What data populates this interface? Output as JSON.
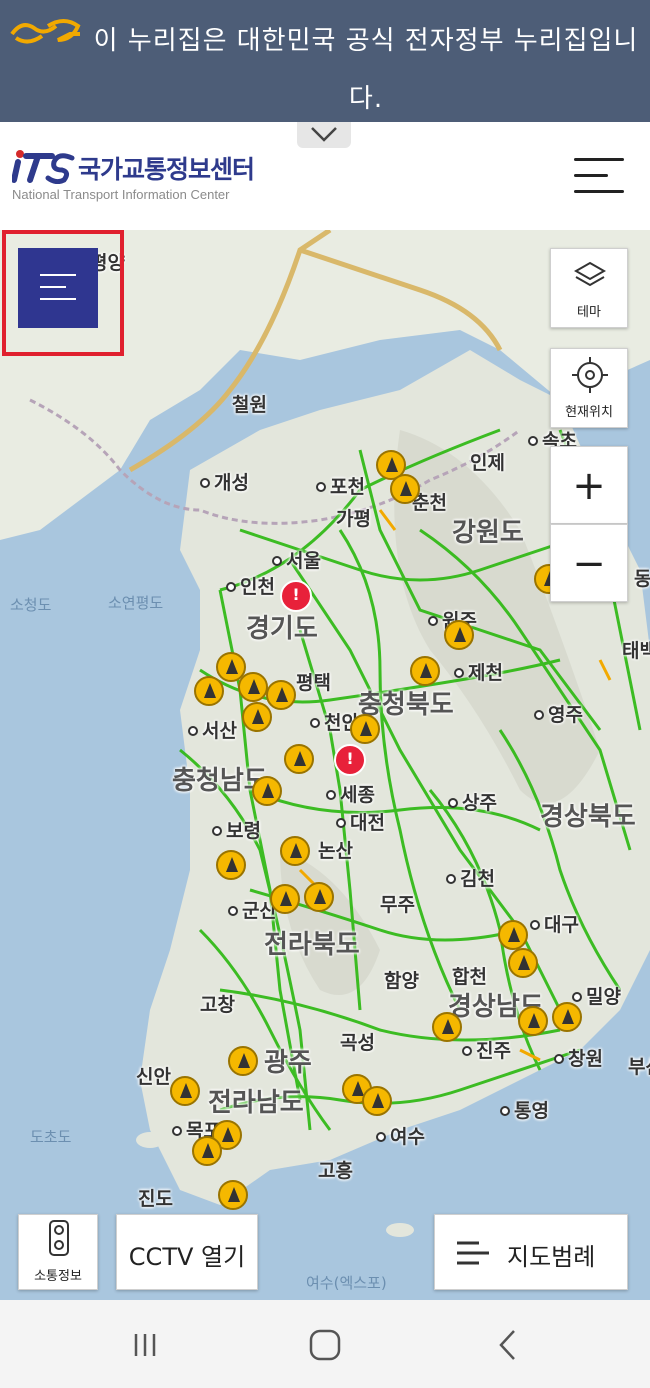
{
  "gov_banner": {
    "text": "이 누리집은 대한민국 공식 전자정부 누리집입니다.",
    "logo_icon": "egovernment-logo-icon"
  },
  "header": {
    "logo_ko": "국가교통정보센터",
    "logo_en": "National Transport Information Center",
    "menu_icon": "hamburger-icon"
  },
  "map": {
    "places": {
      "cheorwon": "철원",
      "gaeseong": "개성",
      "pocheon": "포천",
      "gapyeong": "가평",
      "inje": "인제",
      "sokcho": "속초",
      "chuncheon": "춘천",
      "gangwondo": "강원도",
      "seoul": "서울",
      "incheon": "인천",
      "gyeonggido": "경기도",
      "wonju": "원주",
      "jecheon": "제천",
      "pyeongtaek": "평택",
      "chungcheongbukdo": "충청북도",
      "yeongju": "영주",
      "seosan": "서산",
      "cheonan": "천안",
      "chungcheongnamdo": "충청남도",
      "sejong": "세종",
      "daejeon": "대전",
      "sangju": "상주",
      "gyeongsangbukdo": "경상북도",
      "boryeong": "보령",
      "nonsan": "논산",
      "gimcheon": "김천",
      "gunsan": "군산",
      "muju": "무주",
      "daegu": "대구",
      "jeollabukdo": "전라북도",
      "gochang": "고창",
      "hamyang": "함양",
      "hapcheon": "합천",
      "gyeongsangnamdo": "경상남도",
      "miryang": "밀양",
      "gwangju": "광주",
      "gokseong": "곡성",
      "jinju": "진주",
      "changwon": "창원",
      "sinan": "신안",
      "jeollanamdo": "전라남도",
      "tongyeong": "통영",
      "mokpo": "목포",
      "yeosu": "여수",
      "goheung": "고흥",
      "jindo": "진도",
      "pyongyang": "평양",
      "taebaek": "태백",
      "donghae": "동해",
      "busan": "부산"
    },
    "water": {
      "socheongdo": "소청도",
      "soyeonpyeongdo": "소연평도",
      "dochodo": "도초도",
      "yeosuexpo": "여수(엑스포)"
    },
    "theme_label": "테마",
    "theme_icon": "layers-icon",
    "location_label": "현재위치",
    "location_icon": "crosshair-icon",
    "zoom_in": "+",
    "zoom_out": "−",
    "traffic_label": "소통정보",
    "traffic_icon": "traffic-light-icon",
    "cctv_label": "CCTV 열기",
    "legend_label": "지도범례",
    "legend_icon": "list-icon",
    "side_menu_icon": "menu-icon"
  },
  "colors": {
    "banner": "#4d5d77",
    "brand": "#2f3690",
    "highlight": "#e0202e",
    "road": "#2bb80f",
    "construction": "#f5b800",
    "incident": "#e8213a"
  },
  "nav": {
    "recent_icon": "recent-apps-icon",
    "home_icon": "home-icon",
    "back_icon": "back-icon"
  }
}
